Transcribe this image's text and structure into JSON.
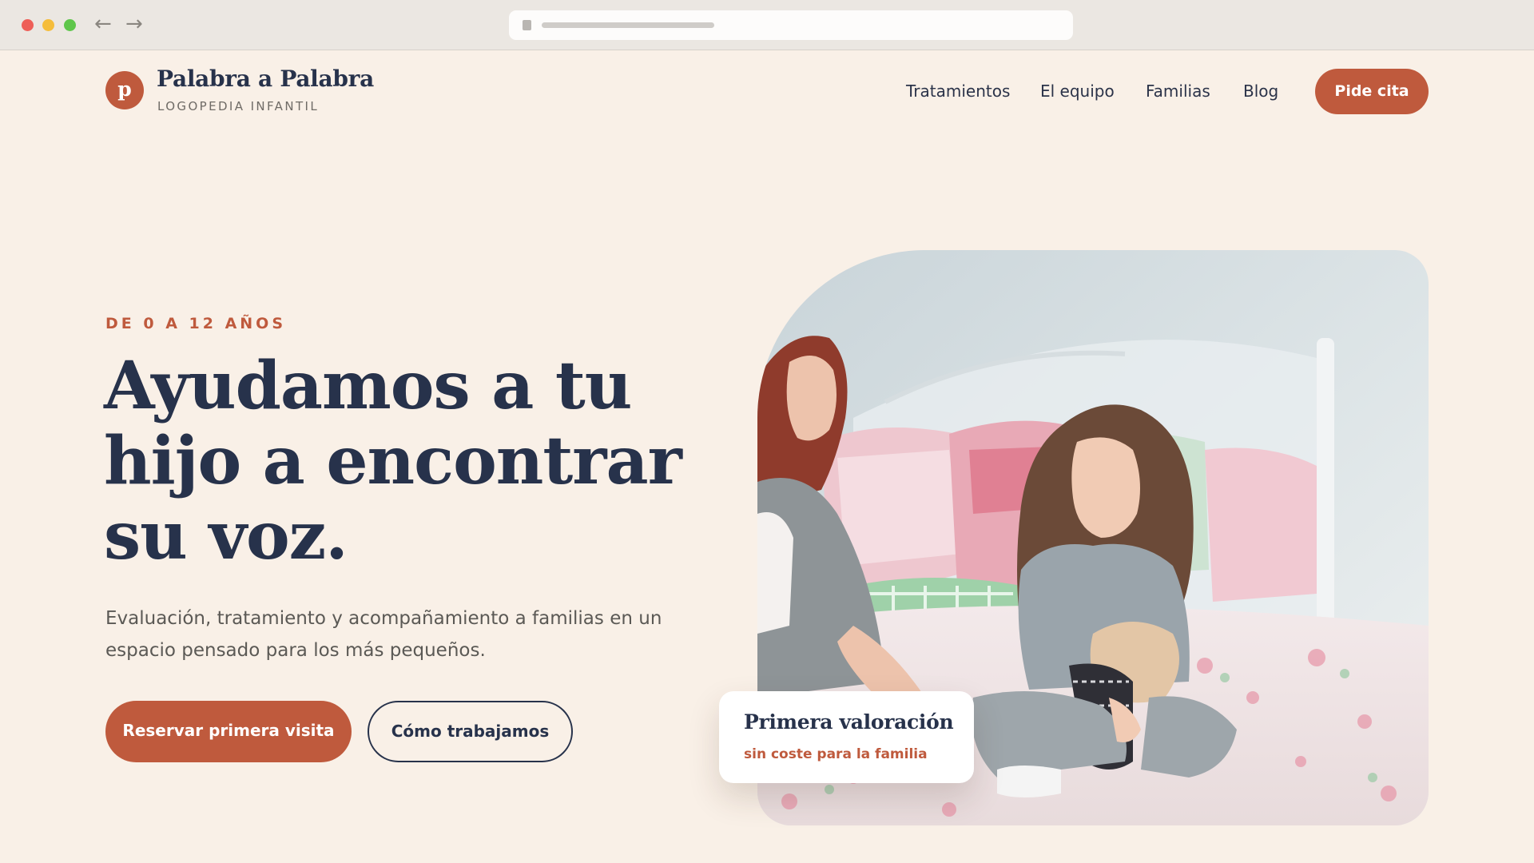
{
  "header": {
    "logo_letter": "p",
    "brand_name": "Palabra a Palabra",
    "brand_tagline": "LOGOPEDIA INFANTIL",
    "nav": [
      "Tratamientos",
      "El equipo",
      "Familias",
      "Blog"
    ],
    "cta_label": "Pide cita"
  },
  "hero": {
    "eyebrow": "DE 0 A 12 AÑOS",
    "title_lines": [
      "Ayudamos a tu",
      "hijo a encontrar",
      "su voz."
    ],
    "description": "Evaluación, tratamiento y acompañamiento a familias en un espacio pensado para los más pequeños.",
    "primary_button": "Reservar primera visita",
    "secondary_button": "Cómo trabajamos"
  },
  "card": {
    "title": "Primera valoración",
    "subtitle": "sin coste para la familia"
  },
  "colors": {
    "accent": "#bf5a3d",
    "navy": "#27324b",
    "background": "#f9f0e7"
  },
  "icons": {
    "back": "arrow-left-icon",
    "forward": "arrow-right-icon",
    "lock": "lock-icon"
  }
}
